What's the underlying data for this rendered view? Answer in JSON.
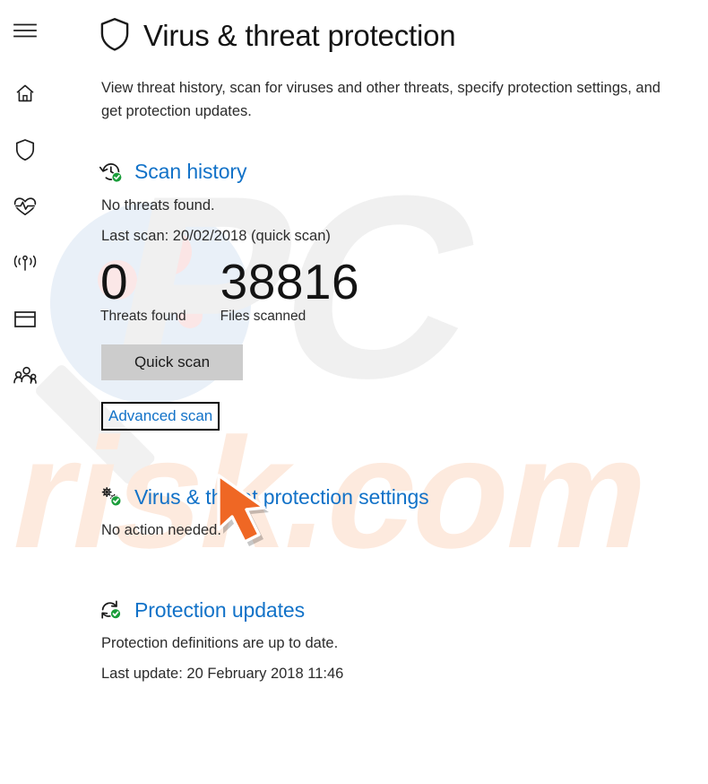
{
  "window": {
    "title": "Virus & threat protection"
  },
  "colors": {
    "link_blue": "#1272c8",
    "heading_black": "#141414",
    "body_gray": "#2b2b2b",
    "quick_scan_button_bg": "#cccccc",
    "status_green": "#1a9d3a",
    "pointer_orange": "#ef6724",
    "watermark_gray": "#f0f0f0",
    "watermark_peach": "#fdeade",
    "watermark_blue": "#e8eff7",
    "watermark_pink": "#fbe6e6"
  },
  "nav_rail": {
    "items": [
      {
        "name": "hamburger-menu-icon",
        "label": "Open navigation"
      },
      {
        "name": "home-icon",
        "label": "Home"
      },
      {
        "name": "shield-icon",
        "label": "Virus & threat protection"
      },
      {
        "name": "heart-pulse-icon",
        "label": "Device performance & health"
      },
      {
        "name": "broadcast-icon",
        "label": "Firewall & network protection"
      },
      {
        "name": "browser-window-icon",
        "label": "App & browser control"
      },
      {
        "name": "family-people-icon",
        "label": "Family options"
      }
    ]
  },
  "header": {
    "icon": "shield-icon",
    "title": "Virus & threat protection",
    "description": "View threat history, scan for viruses and other threats, specify protection settings, and get protection updates."
  },
  "scan_history": {
    "icon": "history-clock-check-icon",
    "title": "Scan history",
    "status": "No threats found.",
    "last_scan": "Last scan: 20/02/2018 (quick scan)",
    "stats": [
      {
        "value": "0",
        "label": "Threats found"
      },
      {
        "value": "38816",
        "label": "Files scanned"
      }
    ],
    "quick_scan_button": "Quick scan",
    "advanced_scan_link": "Advanced scan"
  },
  "protection_settings": {
    "icon": "gears-check-icon",
    "title": "Virus & threat protection settings",
    "status": "No action needed."
  },
  "protection_updates": {
    "icon": "refresh-check-icon",
    "title": "Protection updates",
    "status": "Protection definitions are up to date.",
    "last_update": "Last update: 20 February 2018 11:46"
  },
  "annotation": {
    "pointer": "orange-arrow-cursor",
    "points_at": "Advanced scan"
  },
  "watermark": {
    "text_primary": "PC",
    "text_secondary": "risk.com",
    "shape": "magnifier-glass"
  }
}
